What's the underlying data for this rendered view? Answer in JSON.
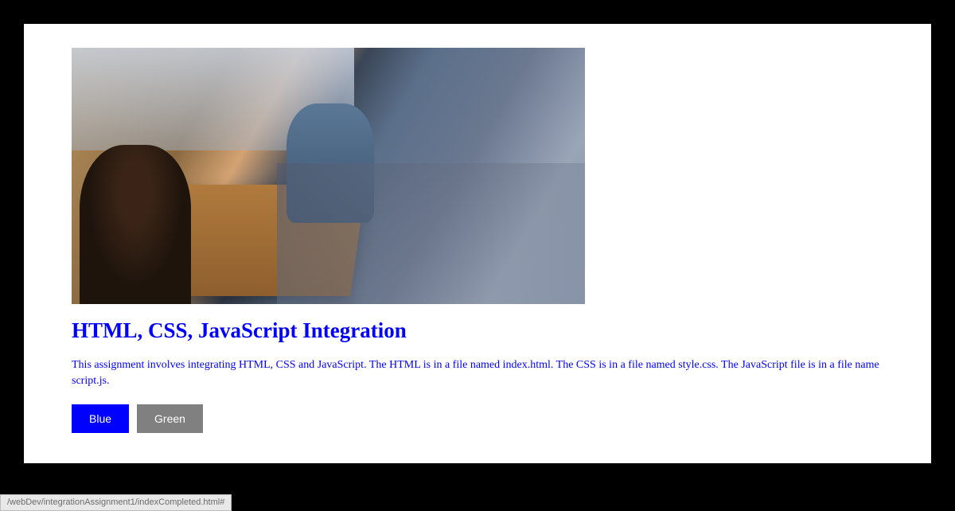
{
  "image": {
    "alt": "Students sitting at wooden tables in a campus lounge area"
  },
  "heading": "HTML, CSS, JavaScript Integration",
  "description": "This assignment involves integrating HTML, CSS and JavaScript. The HTML is in a file named index.html. The CSS is in a file named style.css. The JavaScript file is in a file name script.js.",
  "buttons": {
    "blue": "Blue",
    "green": "Green"
  },
  "status_url": "/webDev/integrationAssignment1/indexCompleted.html#",
  "colors": {
    "text_and_heading": "#0000ff",
    "blue_button_bg": "#0000ff",
    "green_button_bg": "#808080"
  }
}
